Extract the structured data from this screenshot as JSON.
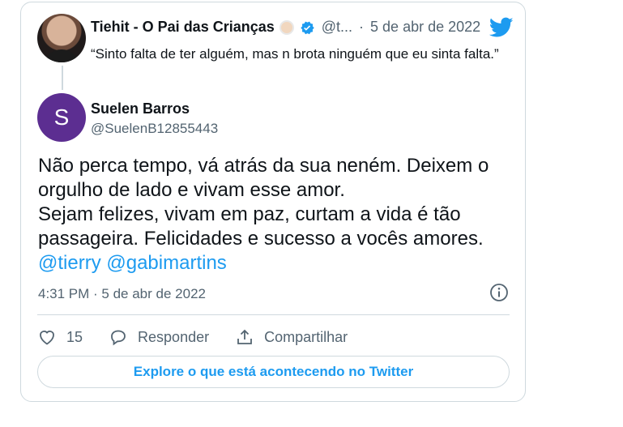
{
  "quoted_tweet": {
    "name": "Tiehit - O Pai das Crianças",
    "handle": "@t...",
    "dot": "·",
    "date": "5 de abr de 2022",
    "text": "“Sinto falta de ter alguém, mas n brota ninguém que eu sinta falta.”"
  },
  "tweet": {
    "author_initial": "S",
    "author_name": "Suelen Barros",
    "author_handle": "@SuelenB12855443",
    "line1": "Não perca tempo, vá atrás da sua neném. Deixem o orgulho de lado e vivam esse amor.",
    "line2": "Sejam felizes, vivam em paz, curtam  a vida é tão passageira. Felicidades e sucesso a vocês amores.",
    "mention1": "@tierry",
    "mention2": "@gabimartins",
    "timestamp": "4:31 PM · 5 de abr de 2022"
  },
  "actions": {
    "like_count": "15",
    "reply_label": "Responder",
    "share_label": "Compartilhar"
  },
  "explore_label": "Explore o que está acontecendo no Twitter",
  "colors": {
    "accent": "#1d9bf0",
    "border": "#cfd9de",
    "muted": "#536471",
    "avatar_bg": "#5c2e91"
  }
}
